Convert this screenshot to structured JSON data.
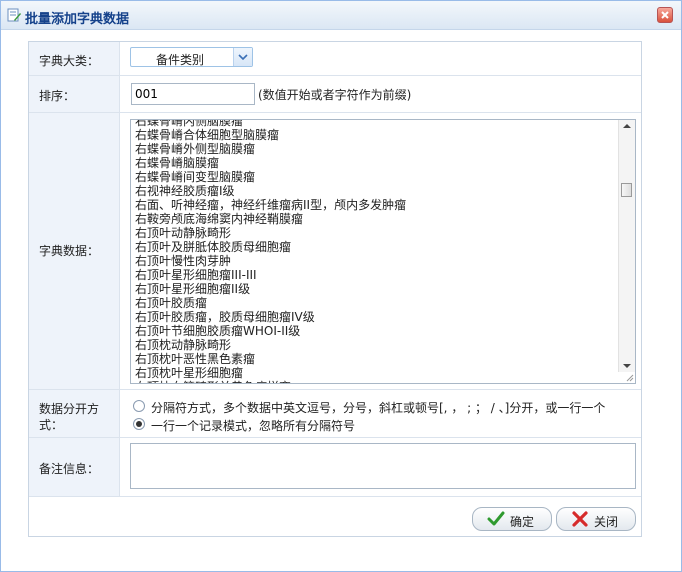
{
  "window": {
    "title": "批量添加字典数据"
  },
  "form": {
    "category": {
      "label": "字典大类：",
      "value": "备件类别"
    },
    "order": {
      "label": "排序：",
      "value": "001",
      "hint": "(数值开始或者字符作为前缀)"
    },
    "data": {
      "label": "字典数据：",
      "lines": [
        "右蝶骨嵴内侧脑膜瘤",
        "右蝶骨嵴合体细胞型脑膜瘤",
        "右蝶骨嵴外侧型脑膜瘤",
        "右蝶骨嵴脑膜瘤",
        "右蝶骨嵴间变型脑膜瘤",
        "右视神经胶质瘤I级",
        "右面、听神经瘤，神经纤维瘤病II型，颅内多发肿瘤",
        "右鞍旁颅底海绵窦内神经鞘膜瘤",
        "右顶叶动静脉畸形",
        "右顶叶及胼胝体胶质母细胞瘤",
        "右顶叶慢性肉芽肿",
        "右顶叶星形细胞瘤III-III",
        "右顶叶星形细胞瘤II级",
        "右顶叶胶质瘤",
        "右顶叶胶质瘤，胶质母细胞瘤IV级",
        "右顶叶节细胞胶质瘤WHOI-II级",
        "右顶枕动静脉畸形",
        "右顶枕叶恶性黑色素瘤",
        "右顶枕叶星形细胞瘤",
        "右顶枕血管畸形并黄色瘤样变"
      ]
    },
    "separator": {
      "label_line1": "数据分开方",
      "label_line2": "式：",
      "option1": "分隔符方式，多个数据中英文逗号，分号，斜杠或顿号[, ， ; ； / 、]分开，或一行一个",
      "option2": "一行一个记录模式，忽略所有分隔符号",
      "selected": "option2"
    },
    "remark": {
      "label": "备注信息：",
      "value": ""
    }
  },
  "buttons": {
    "ok": "确定",
    "close": "关闭"
  },
  "colors": {
    "title": "#15428b",
    "border": "#99bbe8",
    "label_bg": "#eef3fa"
  }
}
